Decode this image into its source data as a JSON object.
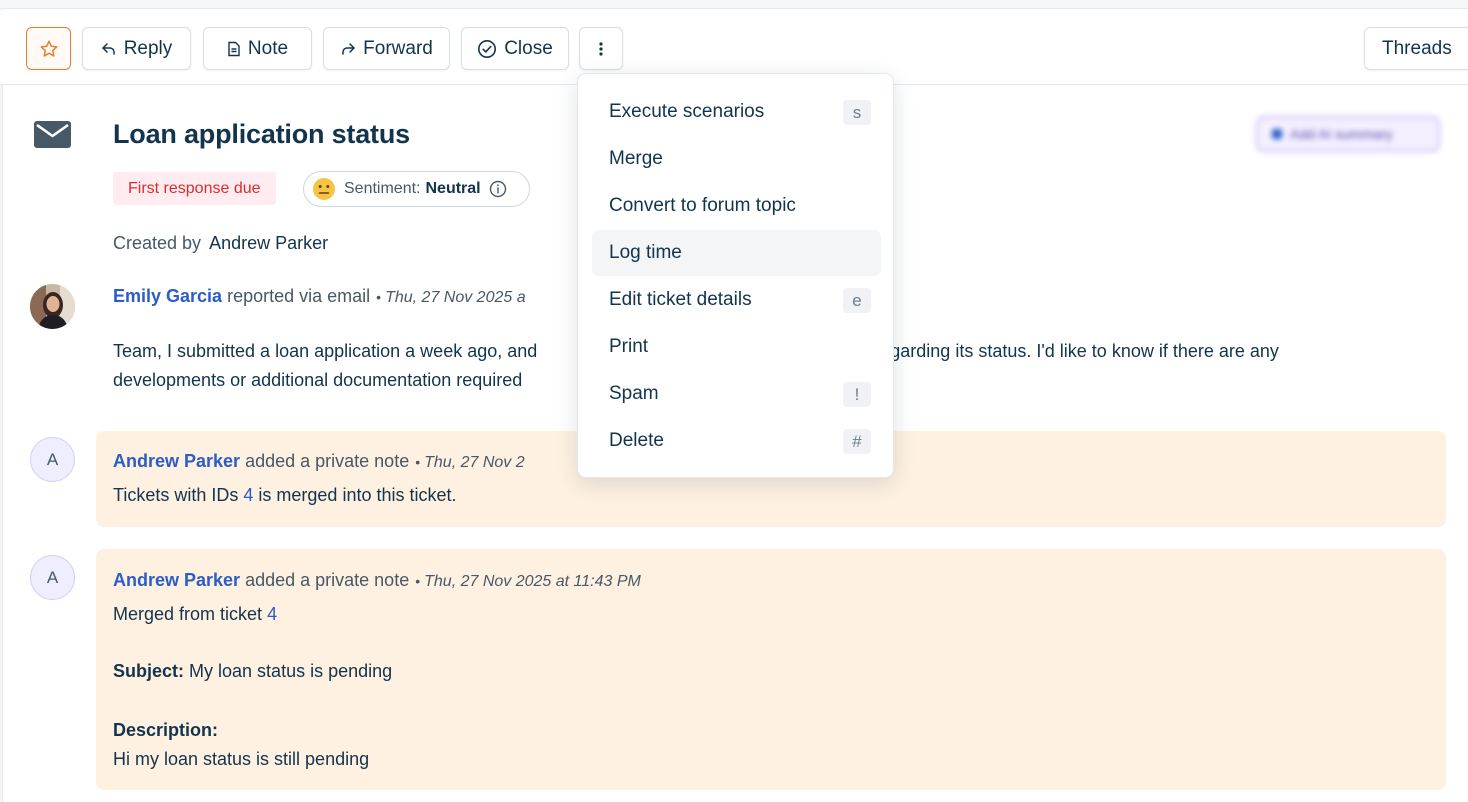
{
  "toolbar": {
    "reply_label": "Reply",
    "note_label": "Note",
    "forward_label": "Forward",
    "close_label": "Close",
    "threads_label": "Threads"
  },
  "ticket": {
    "title": "Loan application status",
    "ai_summary_label": "Add AI summary",
    "badge_due": "First response due",
    "sentiment_label": "Sentiment:",
    "sentiment_value": "Neutral",
    "created_by_label": "Created by",
    "created_by_name": "Andrew Parker"
  },
  "message": {
    "author": "Emily Garcia",
    "action": "reported via email",
    "timestamp": "Thu, 27 Nov 2025 a",
    "body_part1": "Team, I submitted a loan application a week ago, and",
    "body_part2": "s regarding its status. I'd like to know if there are any",
    "body_line2": "developments or additional documentation required"
  },
  "notes": [
    {
      "avatar": "A",
      "author": "Andrew Parker",
      "action": "added a private note",
      "timestamp": "Thu, 27 Nov 2",
      "text_before": "Tickets with IDs",
      "link": "4",
      "text_after": "is merged into this ticket."
    },
    {
      "avatar": "A",
      "author": "Andrew Parker",
      "action": "added a private note",
      "timestamp": "Thu, 27 Nov 2025 at 11:43 PM",
      "text_before": "Merged from ticket",
      "link": "4",
      "subject_label": "Subject:",
      "subject_value": "My loan status is pending",
      "description_label": "Description:",
      "description_value": "Hi my loan status is still pending"
    }
  ],
  "dropdown": {
    "items": [
      {
        "label": "Execute scenarios",
        "shortcut": "s"
      },
      {
        "label": "Merge",
        "shortcut": ""
      },
      {
        "label": "Convert to forum topic",
        "shortcut": ""
      },
      {
        "label": "Log time",
        "shortcut": ""
      },
      {
        "label": "Edit ticket details",
        "shortcut": "e"
      },
      {
        "label": "Print",
        "shortcut": ""
      },
      {
        "label": "Spam",
        "shortcut": "!"
      },
      {
        "label": "Delete",
        "shortcut": "#"
      }
    ],
    "hovered": "Log time"
  },
  "colors": {
    "text": "#12344d",
    "link": "#2c5cc5",
    "star_accent": "#e87d2f",
    "due_badge_bg": "#ffecf0",
    "due_badge_text": "#d72d30",
    "note_bg": "#fef1e1"
  },
  "icons": [
    "star-icon",
    "reply-icon",
    "note-icon",
    "forward-icon",
    "check-circle-icon",
    "more-vertical-icon",
    "mail-icon",
    "neutral-face-icon",
    "info-icon"
  ]
}
